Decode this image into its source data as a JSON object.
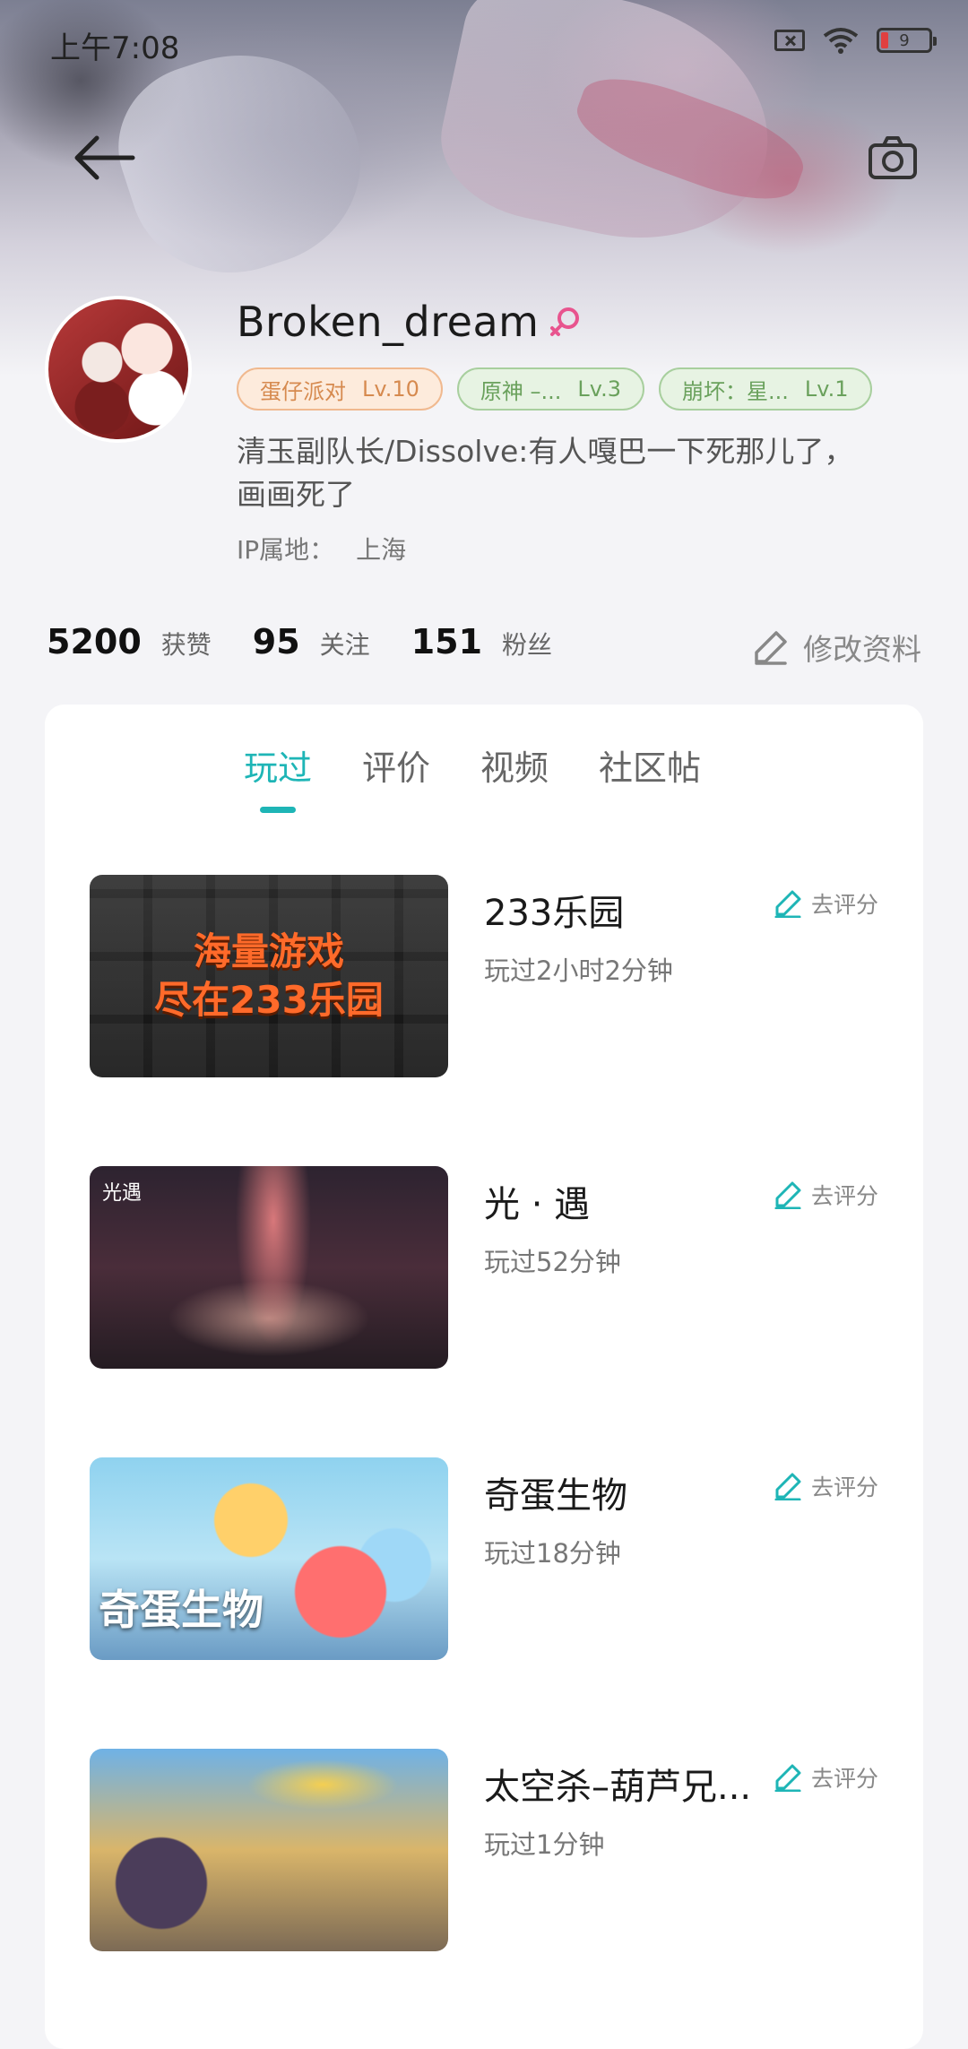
{
  "status_bar": {
    "time": "上午7:08",
    "battery": "9"
  },
  "profile": {
    "username": "Broken_dream",
    "badges": [
      {
        "name": "蛋仔派对",
        "level": "Lv.10",
        "color": "#d68a4f"
      },
      {
        "name": "原神 –...",
        "level": "Lv.3",
        "color": "#6aa15c"
      },
      {
        "name": "崩坏：星...",
        "level": "Lv.1",
        "color": "#6aa15c"
      }
    ],
    "bio": "清玉副队长/Dissolve:有人嘎巴一下死那儿了，画画死了",
    "ip_label": "IP属地：",
    "ip_value": "上海"
  },
  "stats": {
    "likes_count": "5200",
    "likes_label": "获赞",
    "following_count": "95",
    "following_label": "关注",
    "followers_count": "151",
    "followers_label": "粉丝",
    "edit_label": "修改资料"
  },
  "tabs": [
    {
      "label": "玩过",
      "active": true
    },
    {
      "label": "评价",
      "active": false
    },
    {
      "label": "视频",
      "active": false
    },
    {
      "label": "社区帖",
      "active": false
    }
  ],
  "games": [
    {
      "title": "233乐园",
      "played": "玩过2小时2分钟",
      "rate_label": "去评分",
      "thumb_text_1": "海量游戏",
      "thumb_text_2": "尽在233乐园"
    },
    {
      "title": "光 · 遇",
      "played": "玩过52分钟",
      "rate_label": "去评分",
      "thumb_corner": "光遇"
    },
    {
      "title": "奇蛋生物",
      "played": "玩过18分钟",
      "rate_label": "去评分",
      "thumb_caption": "奇蛋生物"
    },
    {
      "title": "太空杀–葫芦兄...",
      "played": "玩过1分钟",
      "rate_label": "去评分"
    }
  ],
  "colors": {
    "accent": "#1eb5b6",
    "badge_orange": "#f0b98f",
    "badge_green": "#a8cf9e",
    "gender_pink": "#e8548e"
  },
  "icons": [
    "back-arrow-icon",
    "camera-icon",
    "female-icon",
    "edit-pen-icon",
    "wifi-icon",
    "sim-icon",
    "battery-icon"
  ]
}
